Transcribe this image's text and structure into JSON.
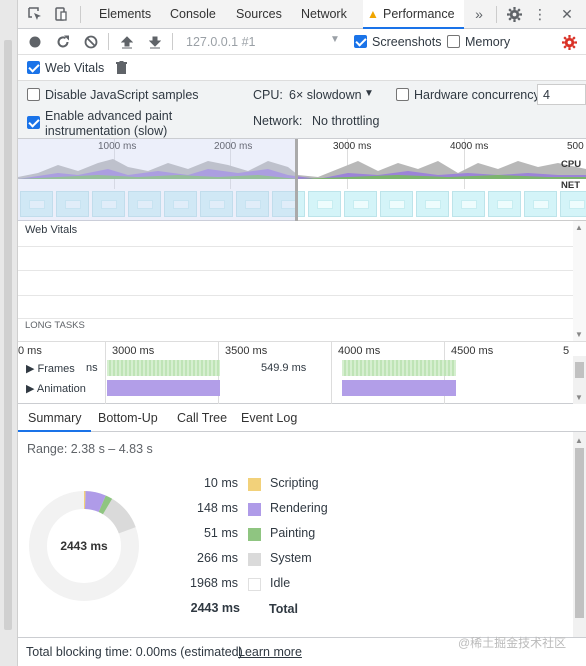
{
  "tabs": [
    "Elements",
    "Console",
    "Sources",
    "Network",
    "Performance"
  ],
  "toolbar": {
    "url": "127.0.0.1 #1",
    "screenshots_label": "Screenshots",
    "screenshots_checked": true,
    "memory_label": "Memory",
    "memory_checked": false
  },
  "web_vitals": {
    "label": "Web Vitals",
    "checked": true
  },
  "settings": {
    "disable_js_label": "Disable JavaScript samples",
    "advanced_paint_label_1": "Enable advanced paint",
    "advanced_paint_label_2": "instrumentation (slow)",
    "cpu_label": "CPU:",
    "cpu_value": "6× slowdown",
    "hw_label": "Hardware concurrency",
    "hw_value": "4",
    "network_label": "Network:",
    "network_value": "No throttling"
  },
  "overview": {
    "ticks": [
      "1000 ms",
      "2000 ms",
      "3000 ms",
      "4000 ms",
      "500"
    ],
    "cpu_label": "CPU",
    "net_label": "NET"
  },
  "vitals_panel": {
    "title": "Web Vitals",
    "long_tasks": "LONG TASKS"
  },
  "flame": {
    "ticks": [
      "0 ms",
      "3000 ms",
      "3500 ms",
      "4000 ms",
      "4500 ms",
      "5"
    ],
    "frames_label": "Frames",
    "frames_ms": "ns",
    "frame_time": "549.9 ms",
    "animation_label": "Animation"
  },
  "bottom_tabs": [
    "Summary",
    "Bottom-Up",
    "Call Tree",
    "Event Log"
  ],
  "summary": {
    "range": "Range: 2.38 s – 4.83 s",
    "total_center": "2443 ms",
    "rows": [
      {
        "ms": "10 ms",
        "label": "Scripting",
        "color": "#f2d17a"
      },
      {
        "ms": "148 ms",
        "label": "Rendering",
        "color": "#af9be8"
      },
      {
        "ms": "51 ms",
        "label": "Painting",
        "color": "#8fc581"
      },
      {
        "ms": "266 ms",
        "label": "System",
        "color": "#dadada"
      },
      {
        "ms": "1968 ms",
        "label": "Idle",
        "color": "#ffffff"
      }
    ],
    "total_ms": "2443 ms",
    "total_label": "Total"
  },
  "footer": {
    "text": "Total blocking time: 0.00ms (estimated)",
    "link": "Learn more",
    "watermark": "@稀土掘金技术社区"
  }
}
